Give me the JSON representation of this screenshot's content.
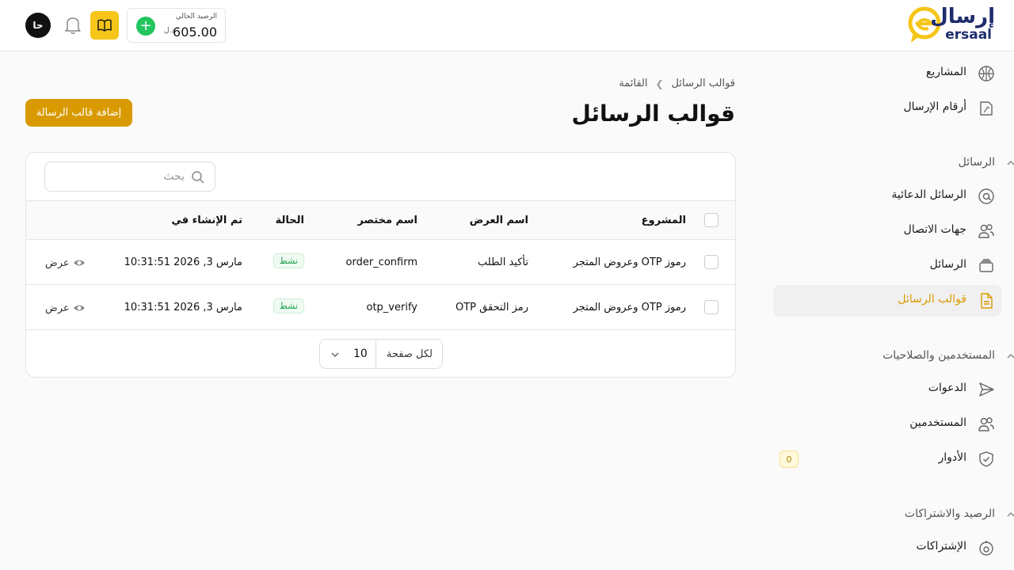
{
  "brand": {
    "name_ar": "إرسال",
    "name_en": "ersaal",
    "accent": "#f5c518",
    "dark": "#1f2d6e"
  },
  "header": {
    "avatar_initials": "حا",
    "balance": {
      "label": "الرصيد الحالي",
      "amount": "605.00",
      "currency": "د.ل"
    }
  },
  "sidebar": {
    "top_items": [
      {
        "label": "المشاريع",
        "icon": "basketball-icon"
      },
      {
        "label": "أرقام الإرسال",
        "icon": "sim-card-icon"
      }
    ],
    "sections": [
      {
        "title": "الرسائل",
        "items": [
          {
            "label": "الرسائل الدعائية",
            "icon": "at-icon"
          },
          {
            "label": "جهات الاتصال",
            "icon": "users-icon"
          },
          {
            "label": "الرسائل",
            "icon": "inbox-icon"
          },
          {
            "label": "قوالب الرسائل",
            "icon": "document-icon",
            "active": true
          }
        ]
      },
      {
        "title": "المستخدمين والصلاحيات",
        "items": [
          {
            "label": "الدعوات",
            "icon": "send-icon"
          },
          {
            "label": "المستخدمين",
            "icon": "users-icon"
          },
          {
            "label": "الأدوار",
            "icon": "shield-check-icon",
            "badge": "0"
          }
        ]
      },
      {
        "title": "الرصيد والاشتراكات",
        "items": [
          {
            "label": "الإشتراكات",
            "icon": "coin-icon"
          }
        ]
      }
    ]
  },
  "page": {
    "breadcrumb": [
      "قوالب الرسائل",
      "القائمة"
    ],
    "title": "قوالب الرسائل",
    "add_button": "إضافة قالب الرسالة"
  },
  "table": {
    "search_placeholder": "بحث",
    "columns": [
      "المشروع",
      "اسم العرض",
      "اسم مختصر",
      "الحالة",
      "تم الإنشاء في"
    ],
    "rows": [
      {
        "project": "رموز OTP وعروض المتجر",
        "display_name": "تأكيد الطلب",
        "short_name": "order_confirm",
        "status": "نشط",
        "created_at": "مارس 3, 2026 10:31:51",
        "action": "عرض"
      },
      {
        "project": "رموز OTP وعروض المتجر",
        "display_name": "رمز التحقق OTP",
        "short_name": "otp_verify",
        "status": "نشط",
        "created_at": "مارس 3, 2026 10:31:51",
        "action": "عرض"
      }
    ],
    "pagination": {
      "per_page_label": "لكل صفحة",
      "per_page": "10"
    }
  }
}
